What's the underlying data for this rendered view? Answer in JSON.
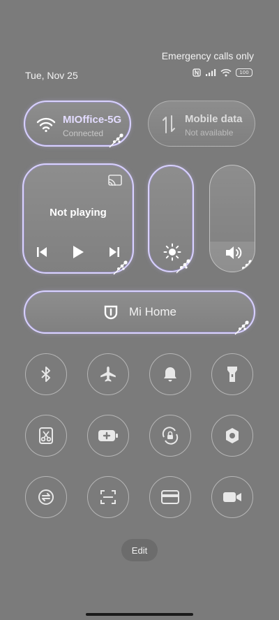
{
  "status_bar": {
    "emergency_text": "Emergency calls only",
    "date": "Tue, Nov 25",
    "battery_level": "100",
    "icons": [
      "nfc-icon",
      "signal-icon",
      "wifi-icon",
      "battery-icon"
    ]
  },
  "tiles": {
    "wifi": {
      "title": "MIOffice-5G",
      "subtitle": "Connected",
      "icon": "wifi-icon",
      "active": true
    },
    "mobile_data": {
      "title": "Mobile data",
      "subtitle": "Not available",
      "icon": "mobile-data-icon",
      "active": false
    },
    "media": {
      "title": "Not playing",
      "icons": [
        "cast-icon",
        "previous-icon",
        "play-icon",
        "next-icon"
      ]
    },
    "brightness": {
      "icon": "brightness-icon",
      "level": 0.0
    },
    "volume": {
      "icon": "volume-icon",
      "level": 0.28
    },
    "mi_home": {
      "label": "Mi Home",
      "icon": "mi-home-icon"
    }
  },
  "toggles": [
    "bluetooth-icon",
    "airplane-mode-icon",
    "bell-icon",
    "flashlight-icon",
    "screenshot-icon",
    "battery-saver-icon",
    "rotation-lock-icon",
    "settings-hex-icon",
    "sync-icon",
    "scanner-icon",
    "card-icon",
    "video-record-icon"
  ],
  "edit_label": "Edit",
  "colors": {
    "background": "#7b7b7b",
    "accent": "#d9d2ff"
  }
}
